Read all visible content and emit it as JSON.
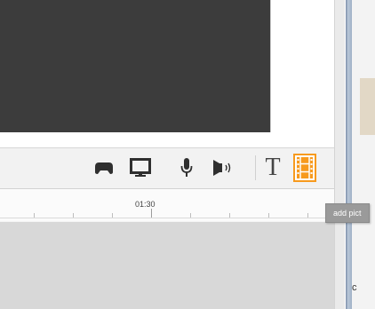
{
  "timeline": {
    "ruler_label": "01:30"
  },
  "toolbar": {
    "tools": [
      {
        "icon": "gamepad-icon"
      },
      {
        "icon": "monitor-icon"
      },
      {
        "icon": "microphone-icon"
      },
      {
        "icon": "speaker-icon"
      },
      {
        "icon": "text-icon",
        "glyph": "T"
      },
      {
        "icon": "film-icon",
        "active": true
      }
    ],
    "active_color": "#f79a1e"
  },
  "tooltip": {
    "text": "add pict"
  },
  "side_text": "c"
}
